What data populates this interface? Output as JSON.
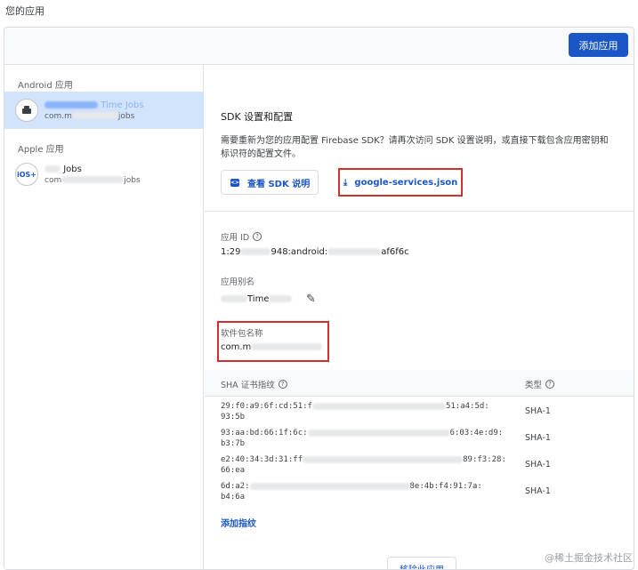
{
  "page": {
    "title": "您的应用"
  },
  "header": {
    "add_app_button": "添加应用"
  },
  "sidebar": {
    "android_section": "Android 应用",
    "apple_section": "Apple 应用",
    "android_app": {
      "name_visible": "Time Jobs",
      "pkg_visible": "com.m",
      "pkg_suffix": "jobs",
      "avatar_icon": "android-icon"
    },
    "apple_app": {
      "name_visible": "Jobs",
      "pkg_visible": "com",
      "pkg_suffix": "jobs",
      "avatar_text": "iOS+"
    }
  },
  "sdk": {
    "title": "SDK 设置和配置",
    "description": "需要重新为您的应用配置 Firebase SDK？请再次访问 SDK 设置说明，或直接下载包含应用密钥和标识符的配置文件。",
    "instructions_button": "查看 SDK 说明",
    "download_link": "google-services.json"
  },
  "app_id": {
    "label": "应用 ID",
    "value_prefix": "1:29",
    "value_mid": "948:android:",
    "value_suffix": "af6f6c"
  },
  "app_nickname": {
    "label": "应用别名",
    "value_visible": "Time"
  },
  "package_name": {
    "label": "软件包名称",
    "value_visible": "com.m"
  },
  "sha": {
    "header_sha": "SHA 证书指纹",
    "header_type": "类型",
    "rows": [
      {
        "start": "29:f0:a9:6f:cd:51:f",
        "end": "51:a4:5d:",
        "line2": "93:5b",
        "type": "SHA-1"
      },
      {
        "start": "93:aa:bd:66:1f:6c:",
        "end": "6:03:4e:d9:",
        "line2": "b3:7b",
        "type": "SHA-1"
      },
      {
        "start": "e2:40:34:3d:31:ff",
        "end": "89:f3:28:",
        "line2": "66:ea",
        "type": "SHA-1"
      },
      {
        "start": "6d:a2:",
        "end": "8e:4b:f4:91:7a:",
        "line2": "b4:6a",
        "type": "SHA-1"
      }
    ],
    "add_fingerprint": "添加指纹"
  },
  "remove_app_button": "移除此应用",
  "watermark": "@稀土掘金技术社区",
  "colors": {
    "primary": "#1a56c6",
    "highlight_box": "#d32f2f",
    "selected_bg": "#d2e3fc"
  }
}
